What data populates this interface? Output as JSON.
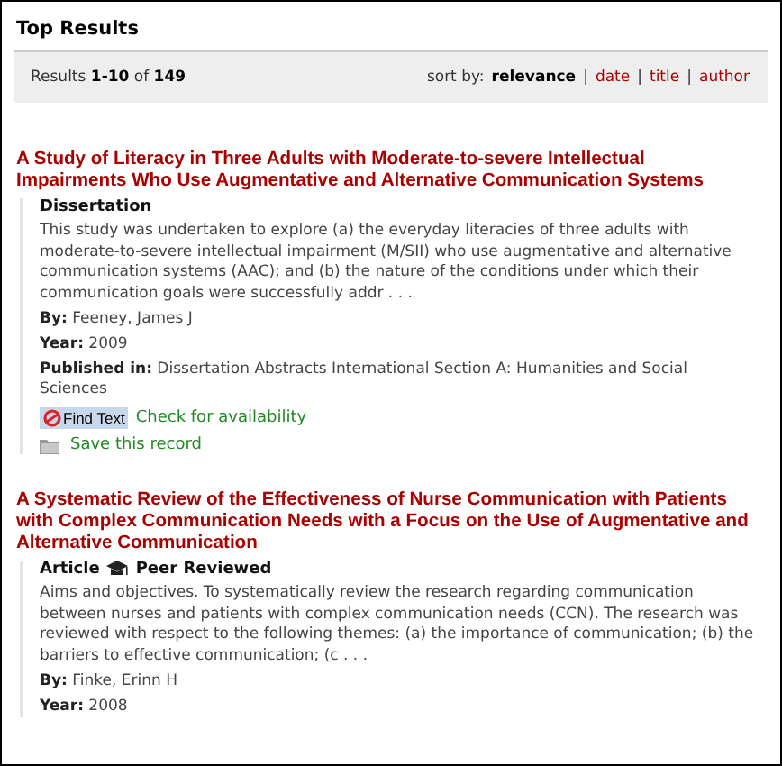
{
  "heading": "Top Results",
  "results_bar": {
    "label": "Results",
    "range": "1-10",
    "of": "of",
    "total": "149",
    "sort_label": "sort by:",
    "separator": "|",
    "sort_options": [
      {
        "label": "relevance",
        "selected": true
      },
      {
        "label": "date",
        "selected": false
      },
      {
        "label": "title",
        "selected": false
      },
      {
        "label": "author",
        "selected": false
      }
    ]
  },
  "results": [
    {
      "title": "A Study of Literacy in Three Adults with Moderate-to-severe Intellectual Impairments Who Use Augmentative and Alternative Communication Systems",
      "type": "Dissertation",
      "peer_reviewed": false,
      "abstract": "This study was undertaken to explore (a) the everyday literacies of three adults with moderate-to-severe intellectual impairment (M/SII) who use augmentative and alternative communication systems (AAC); and (b) the nature of the conditions under which their communication goals were successfully addr . . .",
      "fields": [
        {
          "label": "By:",
          "value": "Feeney, James J"
        },
        {
          "label": "Year:",
          "value": "2009"
        },
        {
          "label": "Published in:",
          "value": "Dissertation Abstracts International Section A: Humanities and Social Sciences"
        }
      ],
      "find_text": {
        "button": "Find Text",
        "link": "Check for availability"
      },
      "save": "Save this record"
    },
    {
      "title": "A Systematic Review of the Effectiveness of Nurse Communication with Patients with Complex Communication Needs with a Focus on the Use of Augmentative and Alternative Communication",
      "type": "Article",
      "peer_reviewed": true,
      "peer_label": "Peer Reviewed",
      "abstract": "Aims and objectives. To systematically review the research regarding communication between nurses and patients with complex communication needs (CCN). The research was reviewed with respect to the following themes: (a) the importance of communication; (b) the barriers to effective communication; (c . . .",
      "fields": [
        {
          "label": "By:",
          "value": "Finke, Erinn H"
        },
        {
          "label": "Year:",
          "value": "2008"
        }
      ]
    }
  ]
}
